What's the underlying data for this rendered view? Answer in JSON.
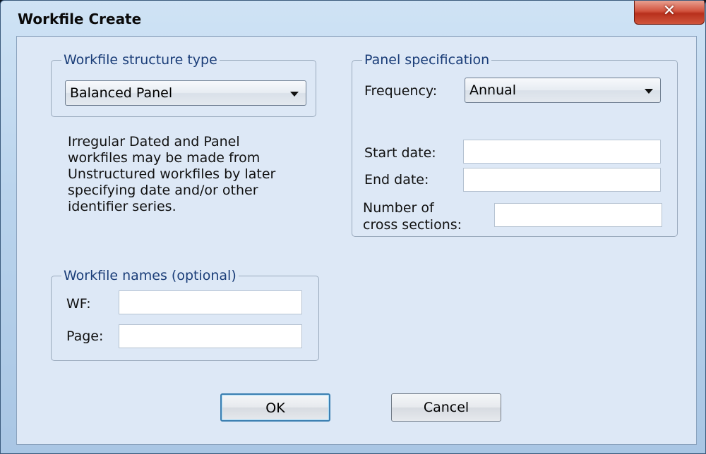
{
  "window": {
    "title": "Workfile Create",
    "close_glyph": "✕"
  },
  "structure": {
    "legend": "Workfile structure type",
    "selected": "Balanced Panel",
    "note": "Irregular Dated and Panel\nworkfiles may be made from\nUnstructured workfiles by later\nspecifying date and/or other\nidentifier series."
  },
  "panel": {
    "legend": "Panel specification",
    "frequency_label": "Frequency:",
    "frequency_value": "Annual",
    "start_label": "Start date:",
    "start_value": "",
    "end_label": "End date:",
    "end_value": "",
    "cross_label_1": "Number of",
    "cross_label_2": "cross sections:",
    "cross_value": ""
  },
  "names": {
    "legend": "Workfile names (optional)",
    "wf_label": "WF:",
    "wf_value": "",
    "page_label": "Page:",
    "page_value": ""
  },
  "buttons": {
    "ok": "OK",
    "cancel": "Cancel"
  },
  "icons": {
    "close": "close-icon",
    "dropdown": "chevron-down-icon"
  }
}
